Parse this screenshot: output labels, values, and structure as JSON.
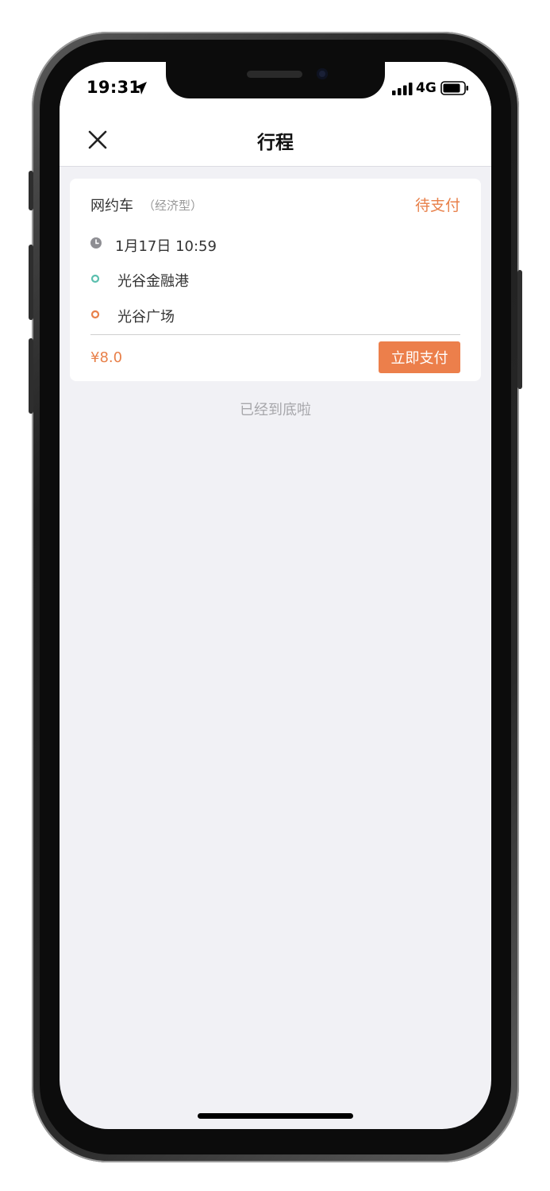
{
  "status_bar": {
    "time": "19:31",
    "network": "4G",
    "icons": [
      "location-arrow-icon",
      "signal-bars-icon",
      "battery-icon"
    ]
  },
  "nav": {
    "title": "行程",
    "close_icon": "close-icon"
  },
  "trip_card": {
    "service_name": "网约车",
    "service_type": "（经济型）",
    "status": "待支付",
    "time": "1月17日 10:59",
    "origin": "光谷金融港",
    "destination": "光谷广场",
    "price": "¥8.0",
    "pay_button_label": "立即支付"
  },
  "list_end_text": "已经到底啦",
  "colors": {
    "accent": "#ec7f4b",
    "origin_dot": "#5bbfae",
    "destination_dot": "#e8804a",
    "page_background": "#f1f1f5"
  }
}
